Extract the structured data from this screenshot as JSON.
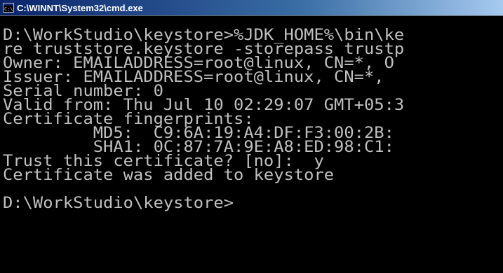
{
  "window": {
    "title": "C:\\WINNT\\System32\\cmd.exe",
    "icon": "cmd-window-icon"
  },
  "console": {
    "lines": [
      "D:\\WorkStudio\\keystore>%JDK_HOME%\\bin\\ke",
      "re truststore.keystore -storepass trustp",
      "Owner: EMAILADDRESS=root@linux, CN=*, O",
      "Issuer: EMAILADDRESS=root@linux, CN=*, ",
      "Serial number: 0",
      "Valid from: Thu Jul 10 02:29:07 GMT+05:3",
      "Certificate fingerprints:",
      "         MD5:  C9:6A:19:A4:DF:F3:00:2B:",
      "         SHA1: 0C:87:7A:9E:A8:ED:98:C1:",
      "Trust this certificate? [no]:  y",
      "Certificate was added to keystore",
      "",
      "D:\\WorkStudio\\keystore>"
    ]
  }
}
